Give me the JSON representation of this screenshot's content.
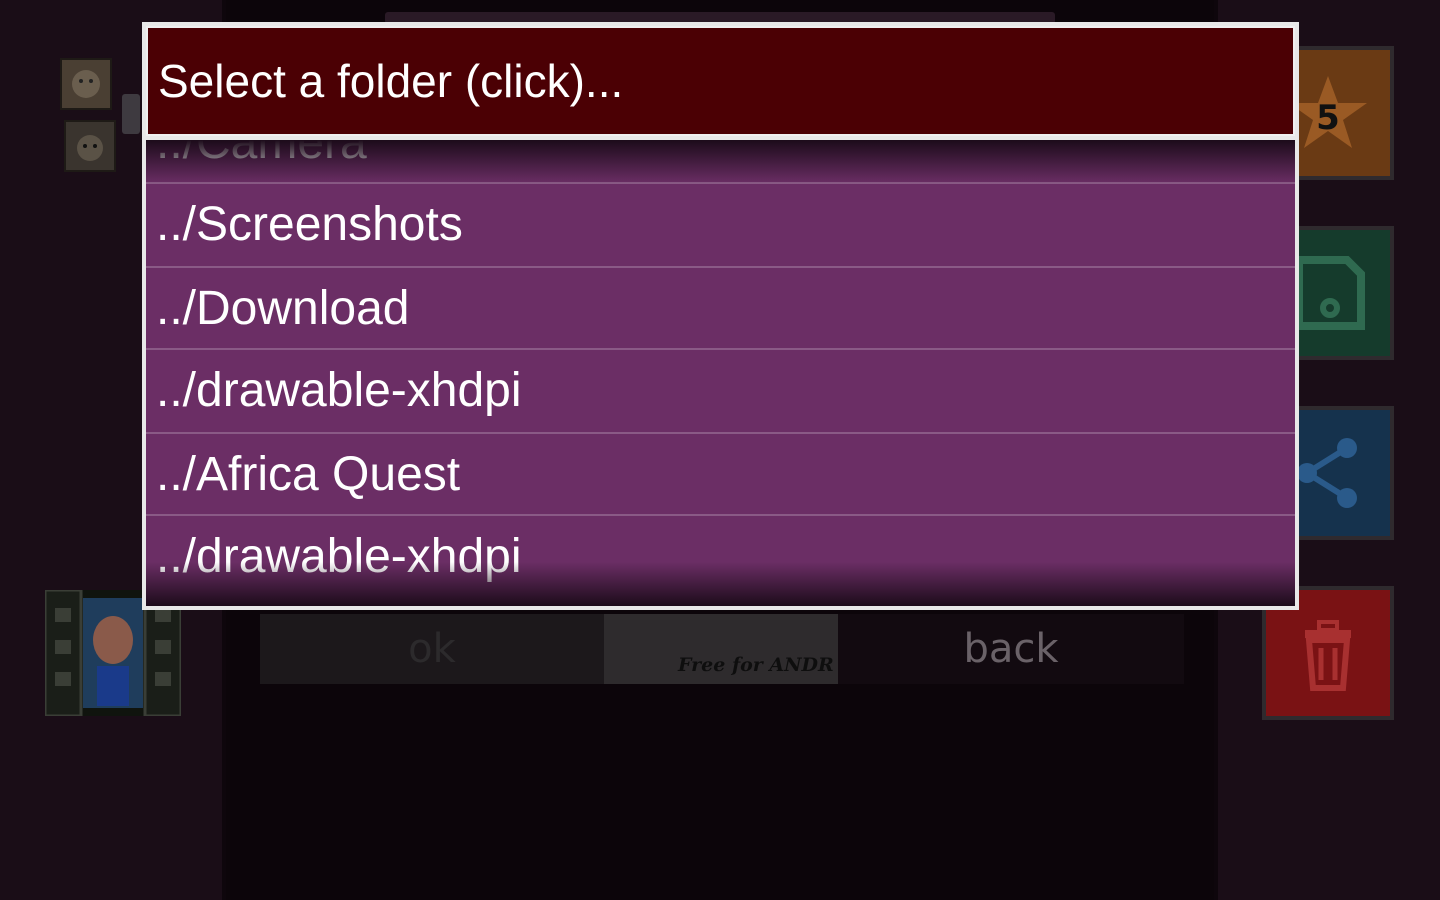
{
  "dialog": {
    "title": "Select a folder (click)...",
    "items": [
      "../Camera",
      "../Screenshots",
      "../Download",
      "../drawable-xhdpi",
      "../Africa Quest",
      "../drawable-xhdpi"
    ]
  },
  "background": {
    "ok_label": "ok",
    "back_label": "back",
    "ad_text": "Free for ANDR",
    "star_count": "5"
  },
  "colors": {
    "title_bg": "#4b0004",
    "list_bg": "#6b2e65",
    "divider": "#8a5a86",
    "text": "#ffffff"
  },
  "icons": {
    "star": "star-icon",
    "save": "floppy-disk-icon",
    "share": "share-icon",
    "trash": "trash-icon",
    "film": "film-strip-icon"
  }
}
